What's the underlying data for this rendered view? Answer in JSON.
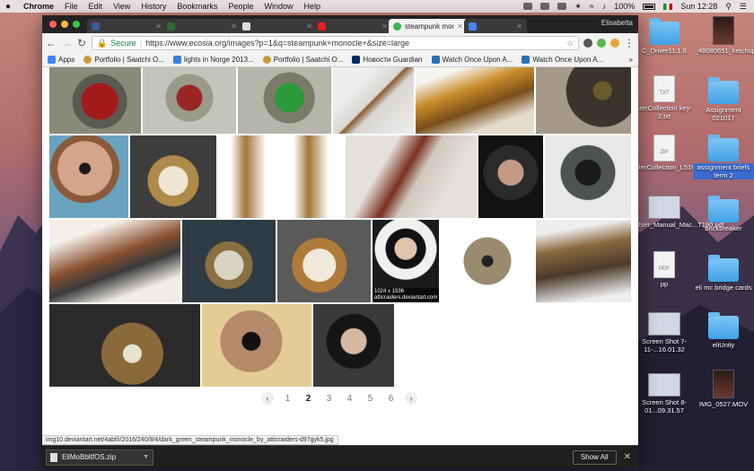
{
  "menubar": {
    "app": "Chrome",
    "items": [
      "File",
      "Edit",
      "View",
      "History",
      "Bookmarks",
      "People",
      "Window",
      "Help"
    ],
    "battery": "100%",
    "clock": "Sun 12:28"
  },
  "browser": {
    "profile": "Elisabetta",
    "tabs": [
      {
        "title": "",
        "color": "#3b5998"
      },
      {
        "title": "",
        "color": "#2f6b2f"
      },
      {
        "title": "",
        "color": "#555555"
      },
      {
        "title": "",
        "color": "#cccccc"
      },
      {
        "title": "",
        "color": "#e62117"
      },
      {
        "title": "steampunk monoc",
        "color": "#39b54a",
        "active": true
      },
      {
        "title": "",
        "color": "#4285f4"
      }
    ],
    "secure_label": "Secure",
    "url": "https://www.ecosia.org/images?p=1&q=steampunk+monocle+&size=large",
    "bookmarks": [
      {
        "label": "Apps",
        "color": "#4285f4"
      },
      {
        "label": "Portfolio | Saatchi O...",
        "color": "#c79a3b"
      },
      {
        "label": "lights in Norge 2013...",
        "color": "#3b7de0"
      },
      {
        "label": "Portfolio | Saatchi O...",
        "color": "#c79a3b"
      },
      {
        "label": "Новости Guardian",
        "color": "#052962"
      },
      {
        "label": "Watch Once Upon A...",
        "color": "#2b6fb6"
      },
      {
        "label": "Watch Once Upon A...",
        "color": "#2b6fb6"
      }
    ],
    "bookmarks_more": "»"
  },
  "results": {
    "captions": {
      "r3_4_size": "1024 x 1536",
      "r3_4_site": "atticraiders.deviantart.com"
    },
    "pagination": {
      "prev": "‹",
      "pages": [
        "1",
        "2",
        "3",
        "4",
        "5",
        "6"
      ],
      "current": "2",
      "next": "›"
    }
  },
  "status_url": "img10.deviantart.net/4abf/i/2016/240/8/4/dark_green_steampunk_monocle_by_atticraiders-d97gyk5.jpg",
  "downloads": {
    "file": "EliMoBbltfOS.zip",
    "show_all": "Show All",
    "close": "✕"
  },
  "desktop": {
    "icons": [
      {
        "label": "C_Driver11.1.8",
        "kind": "folder"
      },
      {
        "label": "_48080651_ketchup.226.jpg",
        "kind": "photo"
      },
      {
        "label": "TXT",
        "sub": "sterCollection key-2.txt",
        "kind": "doc"
      },
      {
        "label": "Assignment 021017",
        "kind": "folder"
      },
      {
        "label": "ZIP",
        "sub": "sterCollection_L516.dmg.zip",
        "kind": "doc"
      },
      {
        "label": "assignment briefs term 2",
        "kind": "folder",
        "selected": true
      },
      {
        "label": "User_Manual_Mac...T190.pdf",
        "kind": "shot"
      },
      {
        "label": "brickbreaker",
        "kind": "folder"
      },
      {
        "label": "PDF",
        "sub": "pp",
        "kind": "doc"
      },
      {
        "label": "eli mc bridge cards",
        "kind": "folder"
      },
      {
        "label": "Screen Shot 7-11-...16.01.32",
        "kind": "shot"
      },
      {
        "label": "eliUnity",
        "kind": "folder"
      },
      {
        "label": "Screen Shot 8-01...09.31.57",
        "kind": "shot"
      },
      {
        "label": "IMG_0527.MOV",
        "kind": "photo"
      }
    ]
  }
}
